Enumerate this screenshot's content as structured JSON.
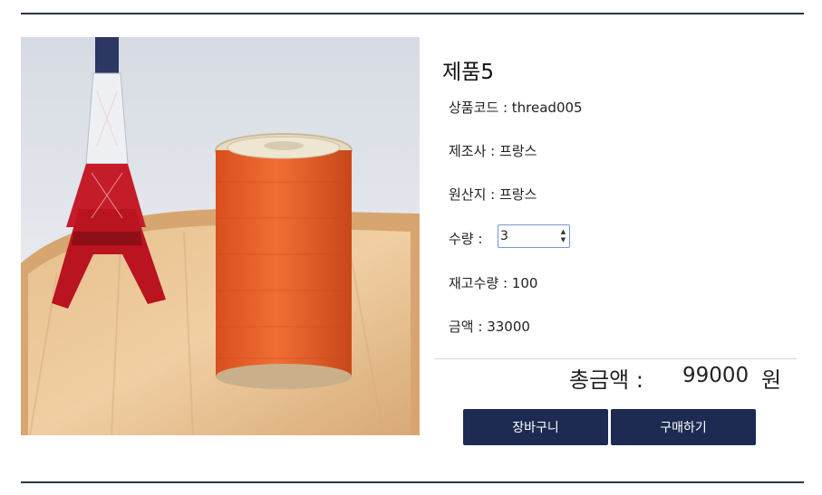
{
  "product": {
    "name": "제품5",
    "code_text": "상품코드 : thread005",
    "maker_text": "제조사 : 프랑스",
    "origin_text": "원산지 : 프랑스",
    "quantity_label": "수량 :",
    "quantity_value": "3",
    "stock_text": "재고수량 : 100",
    "price_text": "금액 : 33000"
  },
  "total": {
    "label": "총금액 :",
    "value": "99000",
    "unit": "원"
  },
  "buttons": {
    "cart": "장바구니",
    "buy": "구매하기"
  },
  "colors": {
    "rule": "#2b3445",
    "button": "#1d2b52",
    "thread": "#e8642c"
  }
}
